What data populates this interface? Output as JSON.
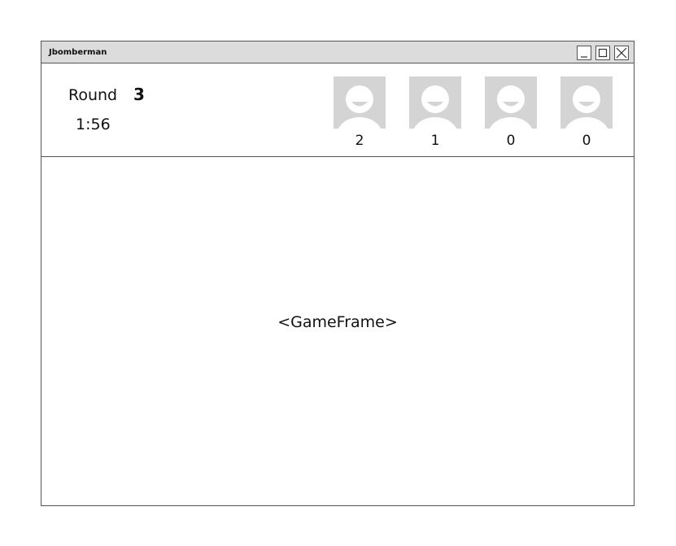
{
  "window": {
    "title": "Jbomberman"
  },
  "header": {
    "round_label": "Round",
    "round_number": "3",
    "timer": "1:56",
    "players": [
      {
        "score": "2"
      },
      {
        "score": "1"
      },
      {
        "score": "0"
      },
      {
        "score": "0"
      }
    ]
  },
  "game_frame": {
    "label": "<GameFrame>"
  },
  "colors": {
    "avatar_bg": "#d4d4d4",
    "titlebar_bg": "#dcdcdc",
    "border": "#555555"
  },
  "icons": {
    "minimize": "minimize-icon",
    "maximize": "maximize-icon",
    "close": "close-icon",
    "avatar": "user-avatar-icon"
  }
}
